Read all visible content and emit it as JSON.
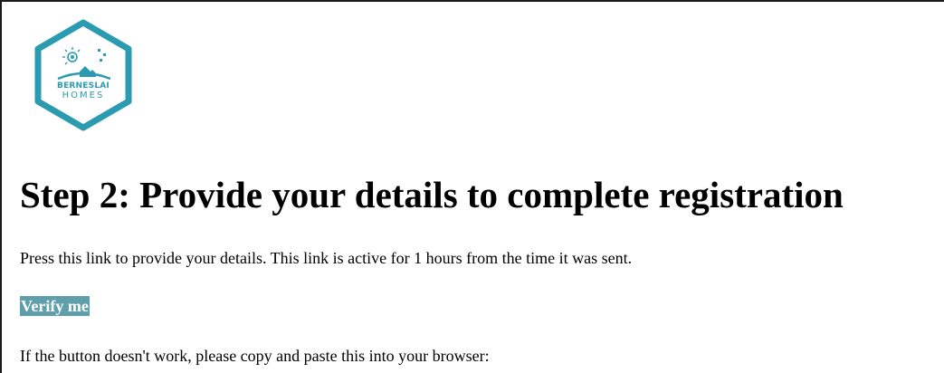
{
  "logo": {
    "icon": "berneslai-homes-logo-icon",
    "brand_line1": "BERNESLAI",
    "brand_line2": "HOMES",
    "color": "#2a9bb0"
  },
  "email": {
    "heading": "Step 2: Provide your details to complete registration",
    "info_text": "Press this link to provide your details. This link is active for 1 hours from the time it was sent.",
    "verify_label": "Verify me",
    "verify_color": "#5f9eab",
    "fallback_text": "If the button doesn't work, please copy and paste this into your browser:"
  }
}
